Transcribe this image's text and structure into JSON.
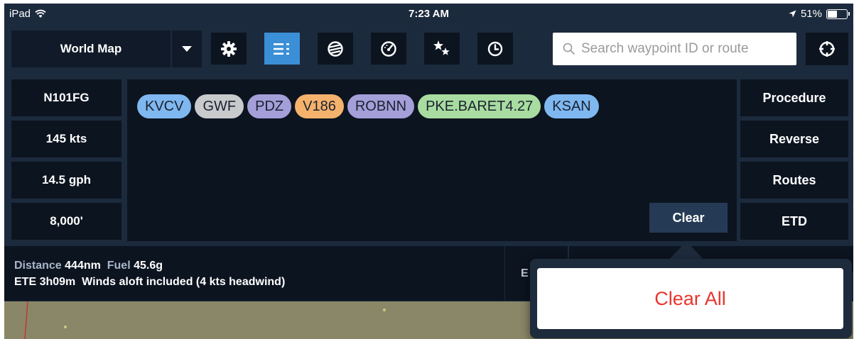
{
  "status_bar": {
    "device": "iPad",
    "time": "7:23 AM",
    "battery": "51%",
    "battery_level": 0.51
  },
  "toolbar": {
    "map_mode": "World Map",
    "icons": [
      "gear-icon",
      "list-icon",
      "globe-icon",
      "gauge-icon",
      "stars-icon",
      "clock-icon"
    ],
    "active_icon": "list-icon",
    "search_placeholder": "Search waypoint ID or route",
    "locate_icon": "crosshair-icon"
  },
  "aircraft": {
    "tail": "N101FG",
    "speed": "145 kts",
    "fuel_burn": "14.5 gph",
    "altitude": "8,000'"
  },
  "route": {
    "waypoints": [
      {
        "id": "KVCV",
        "color": "#7fb8f0"
      },
      {
        "id": "GWF",
        "color": "#c9cacc"
      },
      {
        "id": "PDZ",
        "color": "#a49ed9"
      },
      {
        "id": "V186",
        "color": "#f5b26c"
      },
      {
        "id": "ROBNN",
        "color": "#a49ed9"
      },
      {
        "id": "PKE.BARET4.27",
        "color": "#a8dca0"
      },
      {
        "id": "KSAN",
        "color": "#7fb8f0"
      }
    ],
    "clear_label": "Clear"
  },
  "right_panel": {
    "buttons": [
      "Procedure",
      "Reverse",
      "Routes",
      "ETD"
    ]
  },
  "summary": {
    "distance_label": "Distance",
    "distance_value": "444nm",
    "fuel_label": "Fuel",
    "fuel_value": "45.6g",
    "ete_label": "ETE",
    "ete_value": "3h09m",
    "winds_note": "Winds aloft included (4 kts headwind)",
    "partial_button": "E"
  },
  "popover": {
    "clear_all_label": "Clear All"
  },
  "colors": {
    "accent": "#3a8fd6",
    "destructive": "#e8352d"
  }
}
